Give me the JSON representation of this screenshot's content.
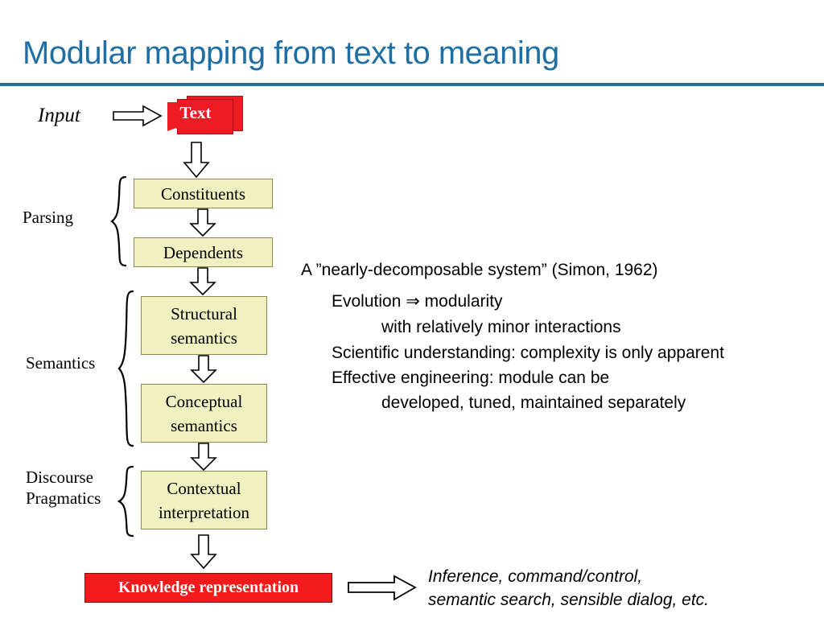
{
  "slide": {
    "title": "Modular mapping from text to meaning",
    "title_color": "#1F6FA5",
    "background": "#ffffff"
  },
  "input": {
    "label": "Input",
    "document_label": "Text",
    "document_color": "#ED1C24",
    "arrow_icon": "right-arrow-icon"
  },
  "stages": [
    {
      "label": "Parsing"
    },
    {
      "label": "Semantics"
    },
    {
      "label": "Discourse\nPragmatics"
    }
  ],
  "pipeline": {
    "box_fill": "#F0F0C0",
    "box_border": "#8A8A4A",
    "boxes": [
      {
        "label": "Constituents"
      },
      {
        "label": "Dependents"
      },
      {
        "line1": "Structural",
        "line2": "semantics"
      },
      {
        "line1": "Conceptual",
        "line2": "semantics"
      },
      {
        "line1": "Contextual",
        "line2": "interpretation"
      }
    ],
    "arrow_icon": "down-arrow-icon"
  },
  "output": {
    "box_label": "Knowledge representation",
    "box_fill": "#F21A1A",
    "box_text_color": "#ffffff",
    "arrow_icon": "right-arrow-icon",
    "caption_line1": "Inference, command/control,",
    "caption_line2": "semantic search, sensible dialog, etc."
  },
  "notes": {
    "line1": "A ”nearly-decomposable system”   (Simon, 1962)",
    "line2": "Evolution ⇒ modularity",
    "line3": "with relatively minor interactions",
    "line4": "Scientific understanding: complexity is only apparent",
    "line5": "Effective engineering: module can be",
    "line6": "developed, tuned, maintained separately"
  }
}
